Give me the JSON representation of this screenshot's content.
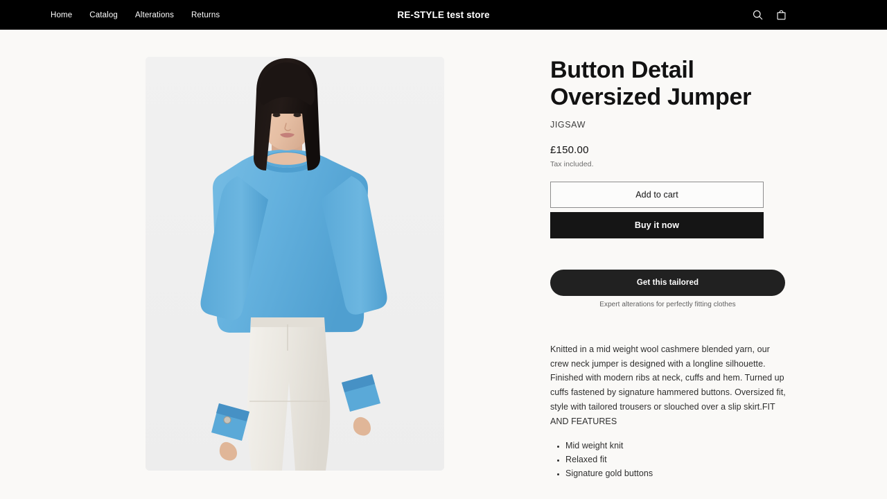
{
  "header": {
    "store_title": "RE-STYLE test store",
    "nav": [
      {
        "label": "Home"
      },
      {
        "label": "Catalog"
      },
      {
        "label": "Alterations"
      },
      {
        "label": "Returns"
      }
    ],
    "actions": [
      {
        "name": "search-icon",
        "label": "Search"
      },
      {
        "name": "cart-icon",
        "label": "Cart"
      }
    ],
    "background_color": "#000000",
    "text_color": "#ffffff"
  },
  "product": {
    "title": "Button Detail Oversized Jumper",
    "vendor": "JIGSAW",
    "price": "£150.00",
    "tax_note": "Tax included.",
    "media": {
      "alt": "Model wearing light blue oversized crew neck jumper with white trousers",
      "background_color": "#efefef",
      "garment_color": "#62b0de"
    },
    "buttons": {
      "add_to_cart": "Add to cart",
      "buy_it_now": "Buy it now"
    },
    "tailoring": {
      "cta_label": "Get this tailored",
      "caption": "Expert alterations for perfectly fitting clothes",
      "background_color": "#212121"
    },
    "description": "Knitted in a mid weight wool cashmere blended yarn, our crew neck jumper is designed with a longline silhouette. Finished with modern ribs at neck, cuffs and hem. Turned up cuffs fastened by signature hammered buttons. Oversized fit, style with tailored trousers or slouched over a slip skirt.FIT AND FEATURES",
    "features": [
      "Mid weight knit",
      "Relaxed fit",
      "Signature gold buttons"
    ]
  },
  "page": {
    "background_color": "#faf9f7"
  }
}
